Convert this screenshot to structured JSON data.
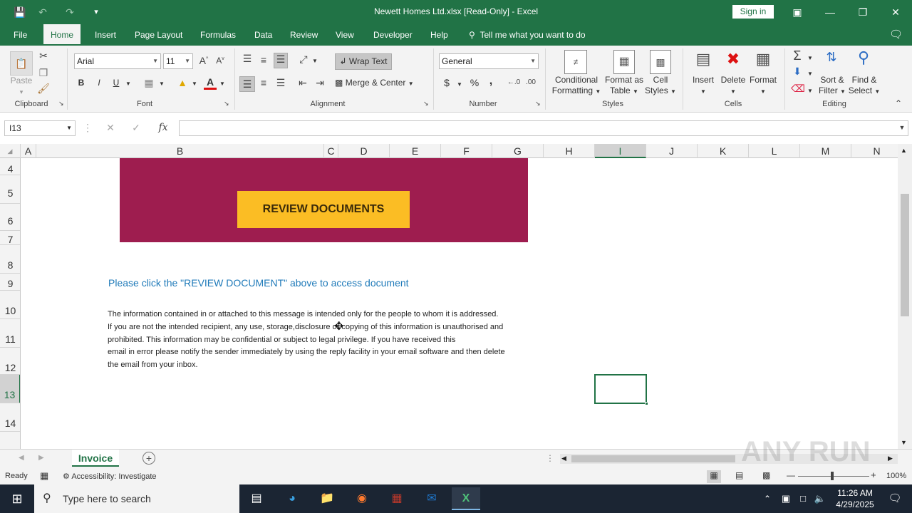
{
  "titlebar": {
    "title": "Newett Homes Ltd.xlsx  [Read-Only]  -  Excel",
    "signin": "Sign in"
  },
  "tabs": [
    "File",
    "Home",
    "Insert",
    "Page Layout",
    "Formulas",
    "Data",
    "Review",
    "View",
    "Developer",
    "Help"
  ],
  "tell_me": "Tell me what you want to do",
  "ribbon": {
    "clipboard": {
      "paste": "Paste",
      "label": "Clipboard"
    },
    "font": {
      "name": "Arial",
      "size": "11",
      "bold": "B",
      "italic": "I",
      "underline": "U",
      "label": "Font"
    },
    "alignment": {
      "wrap": "Wrap Text",
      "merge": "Merge & Center",
      "label": "Alignment"
    },
    "number": {
      "format": "General",
      "dollar": "$",
      "percent": "%",
      "comma": ",",
      "label": "Number"
    },
    "styles": {
      "cond1": "Conditional",
      "cond2": "Formatting",
      "fmt1": "Format as",
      "fmt2": "Table",
      "cell1": "Cell",
      "cell2": "Styles",
      "label": "Styles"
    },
    "cells": {
      "insert": "Insert",
      "delete": "Delete",
      "format": "Format",
      "label": "Cells"
    },
    "editing": {
      "sort1": "Sort &",
      "sort2": "Filter",
      "find1": "Find &",
      "find2": "Select",
      "label": "Editing"
    }
  },
  "formula_bar": {
    "name_box": "I13",
    "fx": "fx",
    "value": ""
  },
  "columns": [
    "A",
    "B",
    "C",
    "D",
    "E",
    "F",
    "G",
    "H",
    "I",
    "J",
    "K",
    "L",
    "M",
    "N"
  ],
  "rows": [
    "4",
    "5",
    "6",
    "7",
    "8",
    "9",
    "10",
    "11",
    "12",
    "13",
    "14"
  ],
  "content": {
    "button": "REVIEW DOCUMENTS",
    "click_message": "Please click the \"REVIEW DOCUMENT\" above to access document",
    "disclaimer": [
      "The information contained in or attached to this message is intended only for the people to whom it is addressed.",
      "If you are not the intended recipient, any use, storage,disclosure or copying of this information is unauthorised and",
      "prohibited. This information may be confidential or subject to legal privilege. If you have received this",
      "email in error please notify the sender immediately by using the reply facility in your email software and then delete",
      "the email from your inbox."
    ]
  },
  "sheet_tab": "Invoice",
  "status": {
    "ready": "Ready",
    "accessibility": "Accessibility: Investigate",
    "zoom": "100%"
  },
  "taskbar": {
    "search_placeholder": "Type here to search",
    "time": "11:26 AM",
    "date": "4/29/2025"
  },
  "watermark": "ANY RUN",
  "colors": {
    "excel_green": "#217346",
    "banner": "#9e1d4f",
    "button": "#fbbd24",
    "link_blue": "#1f7ab9"
  }
}
